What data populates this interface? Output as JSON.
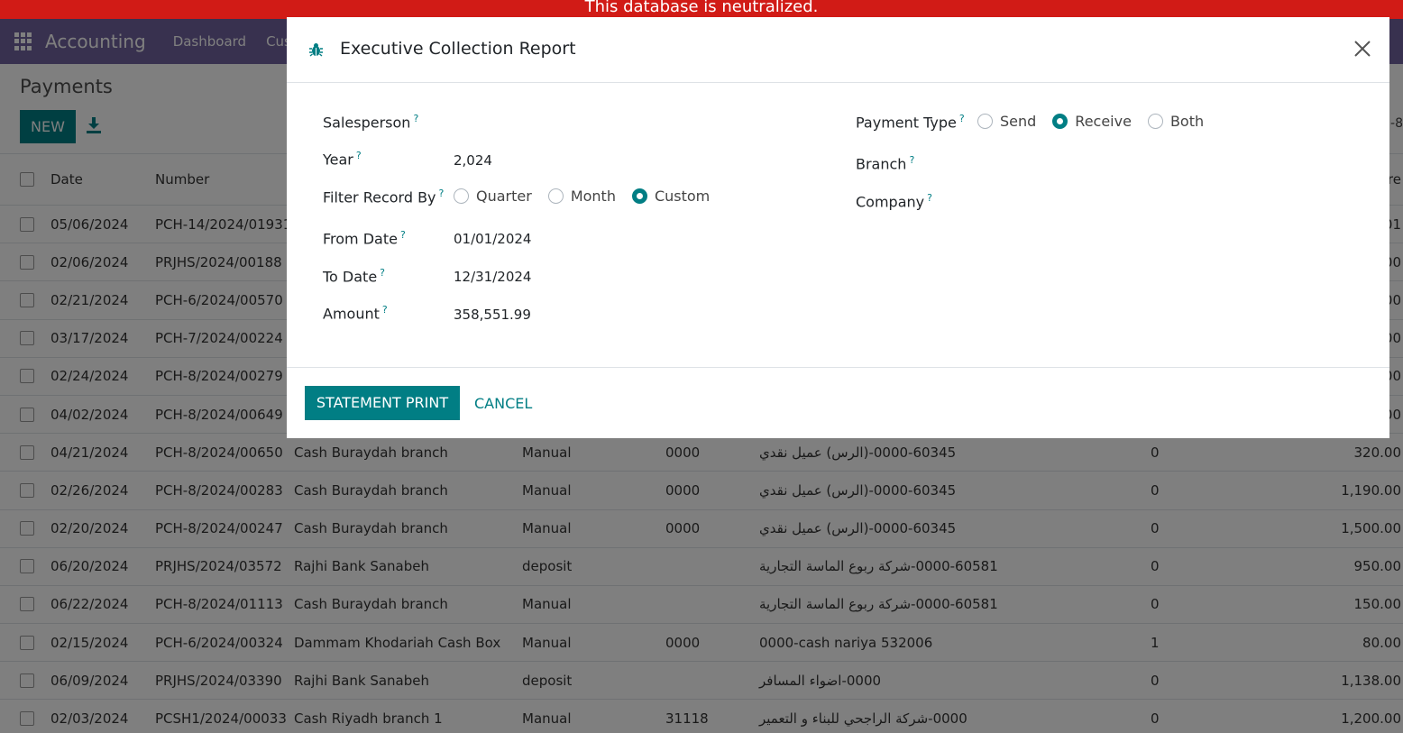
{
  "banner": {
    "text": "This database is neutralized."
  },
  "navbar": {
    "app_name": "Accounting",
    "menus": [
      "Dashboard",
      "Cus"
    ]
  },
  "control_panel": {
    "title": "Payments",
    "new_label": "NEW",
    "pager_fragment": "1-8"
  },
  "list": {
    "headers": {
      "date": "Date",
      "number": "Number",
      "amount_fragment": "re"
    },
    "rows": [
      {
        "date": "05/06/2024",
        "number": "PCH-14/2024/01931",
        "journal": "",
        "method": "",
        "ref": "",
        "partner": "",
        "qty": "",
        "amount": "01"
      },
      {
        "date": "02/06/2024",
        "number": "PRJHS/2024/00188",
        "journal": "",
        "method": "",
        "ref": "",
        "partner": "",
        "qty": "",
        "amount": "00"
      },
      {
        "date": "02/21/2024",
        "number": "PCH-6/2024/00570",
        "journal": "",
        "method": "",
        "ref": "",
        "partner": "",
        "qty": "",
        "amount": "00"
      },
      {
        "date": "03/17/2024",
        "number": "PCH-7/2024/00224",
        "journal": "",
        "method": "",
        "ref": "",
        "partner": "",
        "qty": "",
        "amount": "00"
      },
      {
        "date": "02/24/2024",
        "number": "PCH-8/2024/00279",
        "journal": "",
        "method": "",
        "ref": "",
        "partner": "",
        "qty": "",
        "amount": "00"
      },
      {
        "date": "04/02/2024",
        "number": "PCH-8/2024/00649",
        "journal": "",
        "method": "",
        "ref": "",
        "partner": "",
        "qty": "",
        "amount": "00"
      },
      {
        "date": "04/21/2024",
        "number": "PCH-8/2024/00650",
        "journal": "Cash Buraydah branch",
        "method": "Manual",
        "ref": "0000",
        "partner": "0000-60345-(الرس) عميل نقدي",
        "qty": "0",
        "amount": "320.00"
      },
      {
        "date": "02/26/2024",
        "number": "PCH-8/2024/00283",
        "journal": "Cash Buraydah branch",
        "method": "Manual",
        "ref": "0000",
        "partner": "0000-60345-(الرس) عميل نقدي",
        "qty": "0",
        "amount": "1,190.00"
      },
      {
        "date": "02/20/2024",
        "number": "PCH-8/2024/00247",
        "journal": "Cash Buraydah branch",
        "method": "Manual",
        "ref": "0000",
        "partner": "0000-60345-(الرس) عميل نقدي",
        "qty": "0",
        "amount": "1,500.00"
      },
      {
        "date": "06/20/2024",
        "number": "PRJHS/2024/03572",
        "journal": "Rajhi Bank Sanabeh",
        "method": "deposit",
        "ref": "",
        "partner": "0000-60581-شركة ربوع الماسة التجارية",
        "qty": "0",
        "amount": "950.00"
      },
      {
        "date": "06/22/2024",
        "number": "PCH-8/2024/01113",
        "journal": "Cash Buraydah branch",
        "method": "Manual",
        "ref": "",
        "partner": "0000-60581-شركة ربوع الماسة التجارية",
        "qty": "0",
        "amount": "150.00"
      },
      {
        "date": "02/15/2024",
        "number": "PCH-6/2024/00324",
        "journal": "Dammam Khodariah Cash Box",
        "method": "Manual",
        "ref": "0000",
        "partner": "0000-cash nariya 532006",
        "qty": "1",
        "amount": "80.00"
      },
      {
        "date": "06/09/2024",
        "number": "PRJHS/2024/03390",
        "journal": "Rajhi Bank Sanabeh",
        "method": "deposit",
        "ref": "",
        "partner": "0000-اضواء المسافر",
        "qty": "0",
        "amount": "1,138.00"
      },
      {
        "date": "02/03/2024",
        "number": "PCSH1/2024/00033",
        "journal": "Cash Riyadh branch 1",
        "method": "Manual",
        "ref": "31118",
        "partner": "0000-شركة الراجحي للبناء و التعمير",
        "qty": "0",
        "amount": "1,200.00"
      }
    ]
  },
  "modal": {
    "title": "Executive Collection Report",
    "help_mark": "?",
    "fields": {
      "salesperson": {
        "label": "Salesperson",
        "value": ""
      },
      "year": {
        "label": "Year",
        "value": "2,024"
      },
      "filter_record_by": {
        "label": "Filter Record By",
        "options": [
          "Quarter",
          "Month",
          "Custom"
        ],
        "selected": "Custom"
      },
      "from_date": {
        "label": "From Date",
        "value": "01/01/2024"
      },
      "to_date": {
        "label": "To Date",
        "value": "12/31/2024"
      },
      "amount": {
        "label": "Amount",
        "value": "358,551.99"
      },
      "payment_type": {
        "label": "Payment Type",
        "options": [
          "Send",
          "Receive",
          "Both"
        ],
        "selected": "Receive"
      },
      "branch": {
        "label": "Branch",
        "value": ""
      },
      "company": {
        "label": "Company",
        "value": ""
      }
    },
    "buttons": {
      "primary": "STATEMENT PRINT",
      "cancel": "CANCEL"
    }
  },
  "colors": {
    "brand": "#71639e",
    "accent": "#017e84",
    "banner": "#d11b16"
  }
}
